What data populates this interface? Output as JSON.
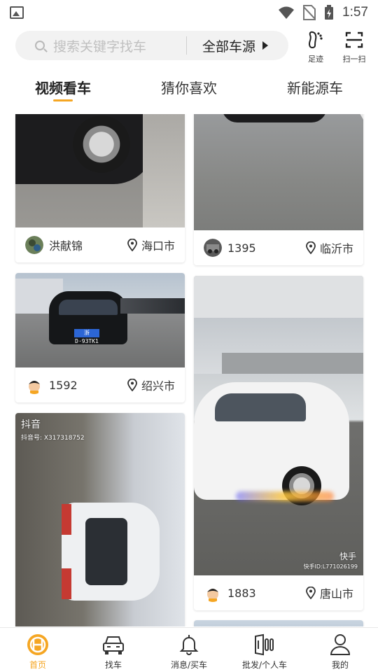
{
  "status_bar": {
    "time": "1:57"
  },
  "search": {
    "placeholder": "搜索关键字找车",
    "source_filter": "全部车源"
  },
  "header_actions": [
    {
      "label": "足迹",
      "icon": "footprint-icon"
    },
    {
      "label": "扫一扫",
      "icon": "scan-icon"
    }
  ],
  "tabs": [
    {
      "label": "视频看车",
      "active": true
    },
    {
      "label": "猜你喜欢",
      "active": false
    },
    {
      "label": "新能源车",
      "active": false
    }
  ],
  "feed": {
    "cards": [
      {
        "user": "洪献锦",
        "city": "海口市"
      },
      {
        "user": "1395",
        "city": "临沂市"
      },
      {
        "user": "1592",
        "city": "绍兴市",
        "plate": "浙D·93TK1"
      },
      {
        "user": "1883",
        "city": "唐山市",
        "watermark_logo": "快手",
        "watermark_id": "快手ID:L771026199"
      },
      {
        "watermark_logo": "抖音",
        "watermark_id": "抖音号: X317318752"
      }
    ]
  },
  "bottom_nav": [
    {
      "label": "首页",
      "icon": "home-logo-icon",
      "active": true
    },
    {
      "label": "找车",
      "icon": "car-icon",
      "active": false
    },
    {
      "label": "消息/买车",
      "icon": "bell-icon",
      "active": false
    },
    {
      "label": "批发/个人车",
      "icon": "wholesale-icon",
      "active": false
    },
    {
      "label": "我的",
      "icon": "user-icon",
      "active": false
    }
  ],
  "colors": {
    "accent": "#f5a623"
  }
}
